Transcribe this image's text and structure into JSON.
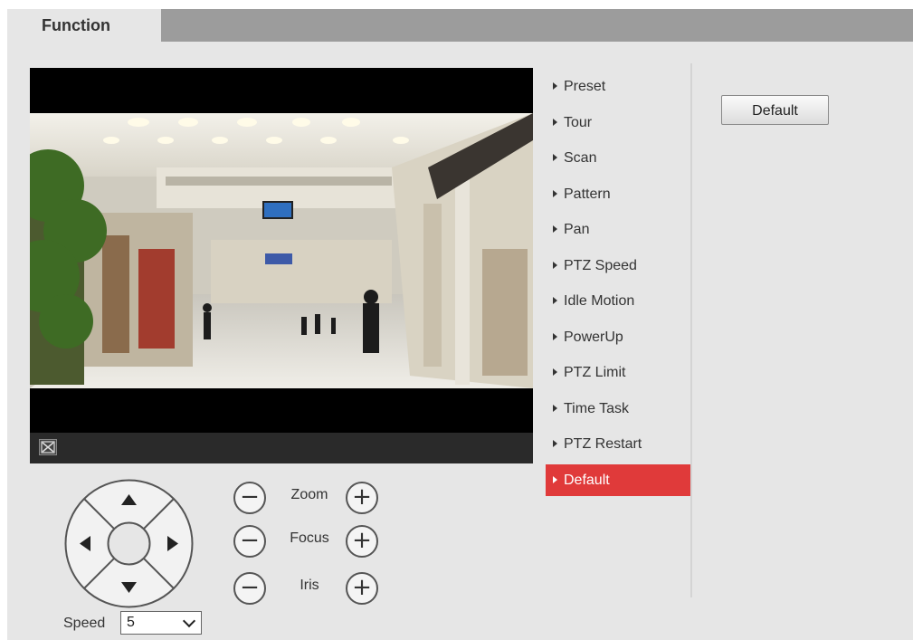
{
  "tabs": {
    "active": "Function"
  },
  "menu": {
    "items": [
      {
        "label": "Preset"
      },
      {
        "label": "Tour"
      },
      {
        "label": "Scan"
      },
      {
        "label": "Pattern"
      },
      {
        "label": "Pan"
      },
      {
        "label": "PTZ Speed"
      },
      {
        "label": "Idle Motion"
      },
      {
        "label": "PowerUp"
      },
      {
        "label": "PTZ Limit"
      },
      {
        "label": "Time Task"
      },
      {
        "label": "PTZ Restart"
      },
      {
        "label": "Default"
      }
    ],
    "active_index": 11
  },
  "actions": {
    "default_label": "Default"
  },
  "ptz": {
    "zoom_label": "Zoom",
    "focus_label": "Focus",
    "iris_label": "Iris",
    "minus": "−",
    "plus": "+"
  },
  "speed": {
    "label": "Speed",
    "value": "5"
  },
  "video": {
    "fullscreen_icon": "fullscreen-icon"
  },
  "colors": {
    "accent": "#e03a3a",
    "tabbar": "#9c9c9c",
    "panel": "#e6e6e6"
  }
}
